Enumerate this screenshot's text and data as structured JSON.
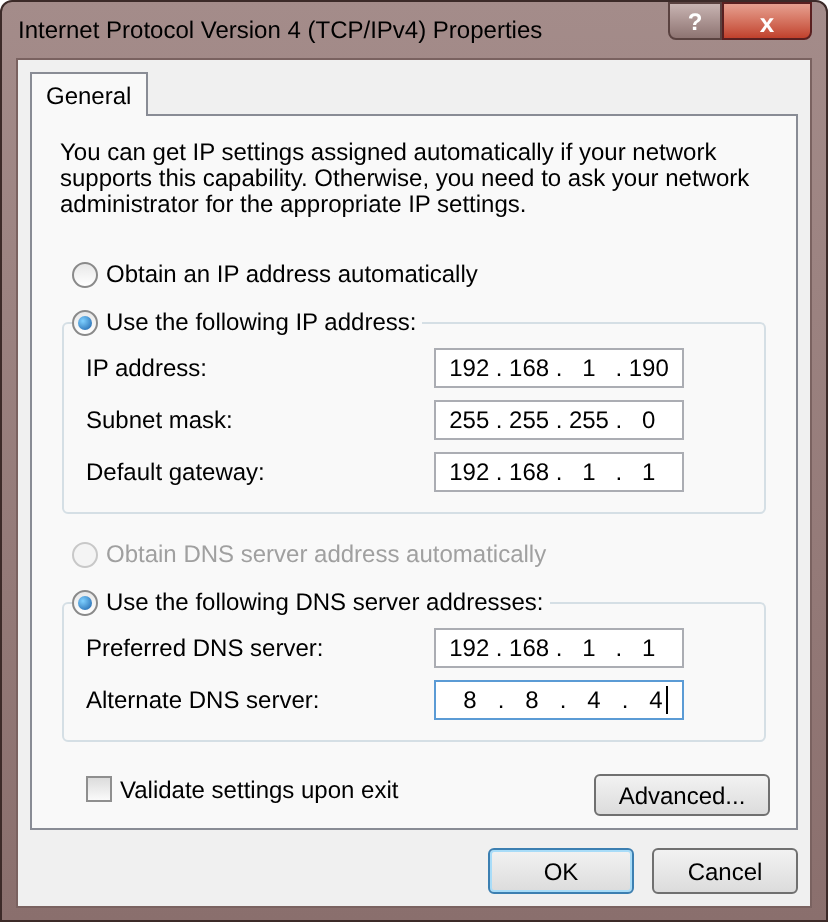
{
  "window": {
    "title": "Internet Protocol Version 4 (TCP/IPv4) Properties",
    "help_button": "?",
    "close_button": "x"
  },
  "tabs": [
    {
      "label": "General",
      "selected": true
    }
  ],
  "description": "You can get IP settings assigned automatically if your network supports this capability. Otherwise, you need to ask your network administrator for the appropriate IP settings.",
  "ip_mode": [
    {
      "label": "Obtain an IP address automatically",
      "selected": false,
      "disabled": false
    },
    {
      "label": "Use the following IP address:",
      "selected": true,
      "disabled": false
    }
  ],
  "ip_fields": [
    {
      "label": "IP address:",
      "value": "192 . 168 . 1 . 190",
      "focused": false
    },
    {
      "label": "Subnet mask:",
      "value": "255 . 255 . 255 . 0",
      "focused": false
    },
    {
      "label": "Default gateway:",
      "value": "192 . 168 . 1 . 1",
      "focused": false
    }
  ],
  "dns_mode": [
    {
      "label": "Obtain DNS server address automatically",
      "selected": false,
      "disabled": true
    },
    {
      "label": "Use the following DNS server addresses:",
      "selected": true,
      "disabled": false
    }
  ],
  "dns_fields": [
    {
      "label": "Preferred DNS server:",
      "value": "192 . 168 . 1 . 1",
      "focused": false
    },
    {
      "label": "Alternate DNS server:",
      "value": "8 . 8 . 4 . 4",
      "focused": true
    }
  ],
  "validate": {
    "label": "Validate settings upon exit",
    "checked": false
  },
  "advanced_button": "Advanced...",
  "buttons": [
    {
      "label": "OK",
      "default": true
    },
    {
      "label": "Cancel",
      "default": false
    }
  ]
}
